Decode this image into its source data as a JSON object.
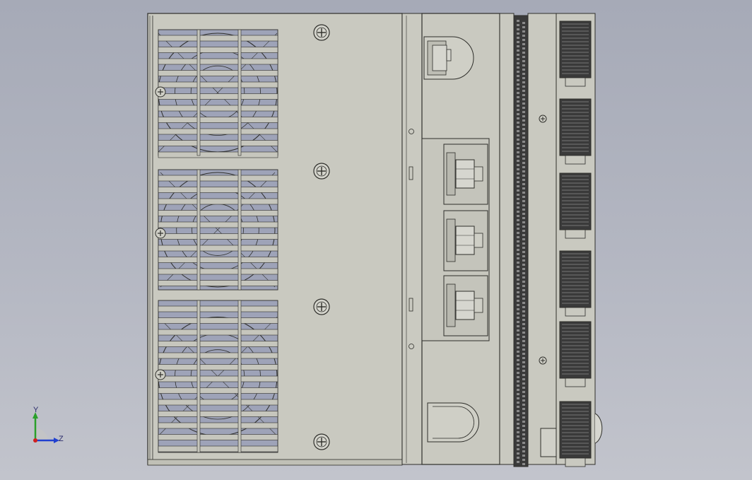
{
  "viewport": {
    "background_top": "#a6aab7",
    "background_bottom": "#c2c4cc"
  },
  "model": {
    "part_fill": "#c9c9c0",
    "part_stroke": "#2e2e2a",
    "grille_fill": "#9ea3b8",
    "dark_fin_fill": "#3a3a3a"
  },
  "triad": {
    "x_label": "",
    "y_label": "Y",
    "z_label": "Z",
    "y_color": "#2aa02a",
    "z_color": "#2040d0",
    "x_color": "#d02020"
  }
}
